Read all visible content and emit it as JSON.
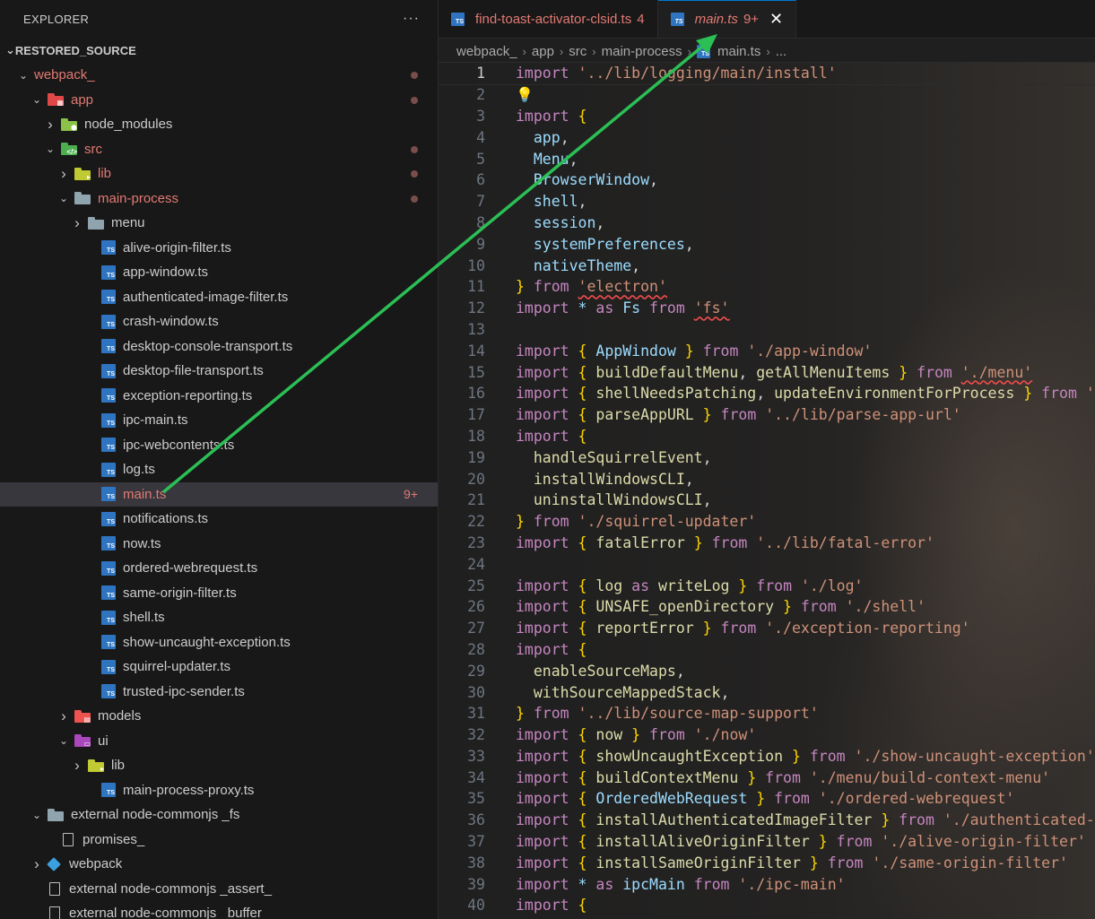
{
  "sidebar": {
    "title": "EXPLORER",
    "more_label": "···",
    "section": "RESTORED_SOURCE",
    "rows": [
      {
        "label": "webpack_",
        "indent": 0,
        "kind": "folder-open",
        "color": "#e27a73",
        "folder": "none",
        "mod": "dot"
      },
      {
        "label": "app",
        "indent": 1,
        "kind": "folder-open",
        "color": "#e27a73",
        "folder": "#e04848",
        "glyph": "▦",
        "mod": "dot"
      },
      {
        "label": "node_modules",
        "indent": 2,
        "kind": "folder-closed",
        "color": "#cccccc",
        "folder": "#8bc34a",
        "glyph": "⬢",
        "mod": ""
      },
      {
        "label": "src",
        "indent": 2,
        "kind": "folder-open",
        "color": "#e27a73",
        "folder": "#4caf50",
        "glyph": "</>",
        "mod": "dot"
      },
      {
        "label": "lib",
        "indent": 3,
        "kind": "folder-closed",
        "color": "#e27a73",
        "folder": "#c0ca33",
        "glyph": "▸",
        "mod": "dot"
      },
      {
        "label": "main-process",
        "indent": 3,
        "kind": "folder-open",
        "color": "#e27a73",
        "folder": "#90a4ae",
        "glyph": "",
        "mod": "dot"
      },
      {
        "label": "menu",
        "indent": 4,
        "kind": "folder-closed",
        "color": "#cccccc",
        "folder": "#90a4ae",
        "glyph": "",
        "mod": ""
      },
      {
        "label": "alive-origin-filter.ts",
        "indent": 5,
        "kind": "ts",
        "color": "#cccccc",
        "mod": ""
      },
      {
        "label": "app-window.ts",
        "indent": 5,
        "kind": "ts",
        "color": "#cccccc",
        "mod": ""
      },
      {
        "label": "authenticated-image-filter.ts",
        "indent": 5,
        "kind": "ts",
        "color": "#cccccc",
        "mod": ""
      },
      {
        "label": "crash-window.ts",
        "indent": 5,
        "kind": "ts",
        "color": "#cccccc",
        "mod": ""
      },
      {
        "label": "desktop-console-transport.ts",
        "indent": 5,
        "kind": "ts",
        "color": "#cccccc",
        "mod": ""
      },
      {
        "label": "desktop-file-transport.ts",
        "indent": 5,
        "kind": "ts",
        "color": "#cccccc",
        "mod": ""
      },
      {
        "label": "exception-reporting.ts",
        "indent": 5,
        "kind": "ts",
        "color": "#cccccc",
        "mod": ""
      },
      {
        "label": "ipc-main.ts",
        "indent": 5,
        "kind": "ts",
        "color": "#cccccc",
        "mod": ""
      },
      {
        "label": "ipc-webcontents.ts",
        "indent": 5,
        "kind": "ts",
        "color": "#cccccc",
        "mod": ""
      },
      {
        "label": "log.ts",
        "indent": 5,
        "kind": "ts",
        "color": "#cccccc",
        "mod": ""
      },
      {
        "label": "main.ts",
        "indent": 5,
        "kind": "ts",
        "color": "#e27a73",
        "mod": "9+",
        "selected": true
      },
      {
        "label": "notifications.ts",
        "indent": 5,
        "kind": "ts",
        "color": "#cccccc",
        "mod": ""
      },
      {
        "label": "now.ts",
        "indent": 5,
        "kind": "ts",
        "color": "#cccccc",
        "mod": ""
      },
      {
        "label": "ordered-webrequest.ts",
        "indent": 5,
        "kind": "ts",
        "color": "#cccccc",
        "mod": ""
      },
      {
        "label": "same-origin-filter.ts",
        "indent": 5,
        "kind": "ts",
        "color": "#cccccc",
        "mod": ""
      },
      {
        "label": "shell.ts",
        "indent": 5,
        "kind": "ts",
        "color": "#cccccc",
        "mod": ""
      },
      {
        "label": "show-uncaught-exception.ts",
        "indent": 5,
        "kind": "ts",
        "color": "#cccccc",
        "mod": ""
      },
      {
        "label": "squirrel-updater.ts",
        "indent": 5,
        "kind": "ts",
        "color": "#cccccc",
        "mod": ""
      },
      {
        "label": "trusted-ipc-sender.ts",
        "indent": 5,
        "kind": "ts",
        "color": "#cccccc",
        "mod": ""
      },
      {
        "label": "models",
        "indent": 3,
        "kind": "folder-closed",
        "color": "#cccccc",
        "folder": "#ef5350",
        "glyph": "▤",
        "mod": ""
      },
      {
        "label": "ui",
        "indent": 3,
        "kind": "folder-open",
        "color": "#cccccc",
        "folder": "#ab47bc",
        "glyph": "▭",
        "mod": ""
      },
      {
        "label": "lib",
        "indent": 4,
        "kind": "folder-closed",
        "color": "#cccccc",
        "folder": "#c0ca33",
        "glyph": "▸",
        "mod": ""
      },
      {
        "label": "main-process-proxy.ts",
        "indent": 5,
        "kind": "ts",
        "color": "#cccccc",
        "mod": ""
      },
      {
        "label": "external node-commonjs _fs",
        "indent": 1,
        "kind": "folder-open",
        "color": "#cccccc",
        "folder": "#90a4ae",
        "glyph": "",
        "mod": ""
      },
      {
        "label": "promises_",
        "indent": 2,
        "kind": "page",
        "color": "#cccccc",
        "mod": ""
      },
      {
        "label": "webpack",
        "indent": 1,
        "kind": "box-closed",
        "color": "#cccccc",
        "mod": ""
      },
      {
        "label": "external node-commonjs _assert_",
        "indent": 1,
        "kind": "page-flat",
        "color": "#cccccc",
        "mod": ""
      },
      {
        "label": "external node-commonjs _buffer",
        "indent": 1,
        "kind": "page-flat",
        "color": "#cccccc",
        "mod": ""
      }
    ]
  },
  "tabs": [
    {
      "label": "find-toast-activator-clsid.ts",
      "problems": "4",
      "active": false
    },
    {
      "label": "main.ts",
      "problems": "9+",
      "active": true,
      "close": "✕"
    }
  ],
  "breadcrumb": [
    "webpack_",
    "app",
    "src",
    "main-process",
    "main.ts",
    "..."
  ],
  "code": [
    [
      [
        "kw",
        "import "
      ],
      [
        "str",
        "'../lib/logging/main/install'"
      ]
    ],
    [
      [
        "bulb",
        "💡"
      ]
    ],
    [
      [
        "kw",
        "import "
      ],
      [
        "brace",
        "{"
      ]
    ],
    [
      [
        "txt",
        "  "
      ],
      [
        "var",
        "app"
      ],
      [
        "txt",
        ","
      ]
    ],
    [
      [
        "txt",
        "  "
      ],
      [
        "var",
        "Menu"
      ],
      [
        "txt",
        ","
      ]
    ],
    [
      [
        "txt",
        "  "
      ],
      [
        "var",
        "BrowserWindow"
      ],
      [
        "txt",
        ","
      ]
    ],
    [
      [
        "txt",
        "  "
      ],
      [
        "var",
        "shell"
      ],
      [
        "txt",
        ","
      ]
    ],
    [
      [
        "txt",
        "  "
      ],
      [
        "var",
        "session"
      ],
      [
        "txt",
        ","
      ]
    ],
    [
      [
        "txt",
        "  "
      ],
      [
        "var",
        "systemPreferences"
      ],
      [
        "txt",
        ","
      ]
    ],
    [
      [
        "txt",
        "  "
      ],
      [
        "var",
        "nativeTheme"
      ],
      [
        "txt",
        ","
      ]
    ],
    [
      [
        "brace",
        "}"
      ],
      [
        "kw",
        " from "
      ],
      [
        "str squig",
        "'electron'"
      ]
    ],
    [
      [
        "kw",
        "import "
      ],
      [
        "var",
        "* "
      ],
      [
        "kw",
        "as "
      ],
      [
        "var",
        "Fs "
      ],
      [
        "kw",
        "from "
      ],
      [
        "str squig",
        "'fs'"
      ]
    ],
    [],
    [
      [
        "kw",
        "import "
      ],
      [
        "brace",
        "{ "
      ],
      [
        "var",
        "AppWindow "
      ],
      [
        "brace",
        "}"
      ],
      [
        "kw",
        " from "
      ],
      [
        "str",
        "'./app-window'"
      ]
    ],
    [
      [
        "kw",
        "import "
      ],
      [
        "brace",
        "{ "
      ],
      [
        "fn",
        "buildDefaultMenu"
      ],
      [
        "txt",
        ", "
      ],
      [
        "fn",
        "getAllMenuItems "
      ],
      [
        "brace",
        "}"
      ],
      [
        "kw",
        " from "
      ],
      [
        "str squig",
        "'./menu'"
      ]
    ],
    [
      [
        "kw",
        "import "
      ],
      [
        "brace",
        "{ "
      ],
      [
        "fn",
        "shellNeedsPatching"
      ],
      [
        "txt",
        ", "
      ],
      [
        "fn",
        "updateEnvironmentForProcess "
      ],
      [
        "brace",
        "}"
      ],
      [
        "kw",
        " from "
      ],
      [
        "str",
        "'..."
      ]
    ],
    [
      [
        "kw",
        "import "
      ],
      [
        "brace",
        "{ "
      ],
      [
        "fn",
        "parseAppURL "
      ],
      [
        "brace",
        "}"
      ],
      [
        "kw",
        " from "
      ],
      [
        "str",
        "'../lib/parse-app-url'"
      ]
    ],
    [
      [
        "kw",
        "import "
      ],
      [
        "brace",
        "{"
      ]
    ],
    [
      [
        "txt",
        "  "
      ],
      [
        "fn",
        "handleSquirrelEvent"
      ],
      [
        "txt",
        ","
      ]
    ],
    [
      [
        "txt",
        "  "
      ],
      [
        "fn",
        "installWindowsCLI"
      ],
      [
        "txt",
        ","
      ]
    ],
    [
      [
        "txt",
        "  "
      ],
      [
        "fn",
        "uninstallWindowsCLI"
      ],
      [
        "txt",
        ","
      ]
    ],
    [
      [
        "brace",
        "}"
      ],
      [
        "kw",
        " from "
      ],
      [
        "str",
        "'./squirrel-updater'"
      ]
    ],
    [
      [
        "kw",
        "import "
      ],
      [
        "brace",
        "{ "
      ],
      [
        "fn",
        "fatalError "
      ],
      [
        "brace",
        "}"
      ],
      [
        "kw",
        " from "
      ],
      [
        "str",
        "'../lib/fatal-error'"
      ]
    ],
    [],
    [
      [
        "kw",
        "import "
      ],
      [
        "brace",
        "{ "
      ],
      [
        "fn",
        "log "
      ],
      [
        "kw",
        "as "
      ],
      [
        "fn",
        "writeLog "
      ],
      [
        "brace",
        "}"
      ],
      [
        "kw",
        " from "
      ],
      [
        "str",
        "'./log'"
      ]
    ],
    [
      [
        "kw",
        "import "
      ],
      [
        "brace",
        "{ "
      ],
      [
        "fn",
        "UNSAFE_openDirectory "
      ],
      [
        "brace",
        "}"
      ],
      [
        "kw",
        " from "
      ],
      [
        "str",
        "'./shell'"
      ]
    ],
    [
      [
        "kw",
        "import "
      ],
      [
        "brace",
        "{ "
      ],
      [
        "fn",
        "reportError "
      ],
      [
        "brace",
        "}"
      ],
      [
        "kw",
        " from "
      ],
      [
        "str",
        "'./exception-reporting'"
      ]
    ],
    [
      [
        "kw",
        "import "
      ],
      [
        "brace",
        "{"
      ]
    ],
    [
      [
        "txt",
        "  "
      ],
      [
        "fn",
        "enableSourceMaps"
      ],
      [
        "txt",
        ","
      ]
    ],
    [
      [
        "txt",
        "  "
      ],
      [
        "fn",
        "withSourceMappedStack"
      ],
      [
        "txt",
        ","
      ]
    ],
    [
      [
        "brace",
        "}"
      ],
      [
        "kw",
        " from "
      ],
      [
        "str",
        "'../lib/source-map-support'"
      ]
    ],
    [
      [
        "kw",
        "import "
      ],
      [
        "brace",
        "{ "
      ],
      [
        "fn",
        "now "
      ],
      [
        "brace",
        "}"
      ],
      [
        "kw",
        " from "
      ],
      [
        "str",
        "'./now'"
      ]
    ],
    [
      [
        "kw",
        "import "
      ],
      [
        "brace",
        "{ "
      ],
      [
        "fn",
        "showUncaughtException "
      ],
      [
        "brace",
        "}"
      ],
      [
        "kw",
        " from "
      ],
      [
        "str",
        "'./show-uncaught-exception'"
      ]
    ],
    [
      [
        "kw",
        "import "
      ],
      [
        "brace",
        "{ "
      ],
      [
        "fn",
        "buildContextMenu "
      ],
      [
        "brace",
        "}"
      ],
      [
        "kw",
        " from "
      ],
      [
        "str",
        "'./menu/build-context-menu'"
      ]
    ],
    [
      [
        "kw",
        "import "
      ],
      [
        "brace",
        "{ "
      ],
      [
        "var",
        "OrderedWebRequest "
      ],
      [
        "brace",
        "}"
      ],
      [
        "kw",
        " from "
      ],
      [
        "str",
        "'./ordered-webrequest'"
      ]
    ],
    [
      [
        "kw",
        "import "
      ],
      [
        "brace",
        "{ "
      ],
      [
        "fn",
        "installAuthenticatedImageFilter "
      ],
      [
        "brace",
        "}"
      ],
      [
        "kw",
        " from "
      ],
      [
        "str",
        "'./authenticated-ima"
      ]
    ],
    [
      [
        "kw",
        "import "
      ],
      [
        "brace",
        "{ "
      ],
      [
        "fn",
        "installAliveOriginFilter "
      ],
      [
        "brace",
        "}"
      ],
      [
        "kw",
        " from "
      ],
      [
        "str",
        "'./alive-origin-filter'"
      ]
    ],
    [
      [
        "kw",
        "import "
      ],
      [
        "brace",
        "{ "
      ],
      [
        "fn",
        "installSameOriginFilter "
      ],
      [
        "brace",
        "}"
      ],
      [
        "kw",
        " from "
      ],
      [
        "str",
        "'./same-origin-filter'"
      ]
    ],
    [
      [
        "kw",
        "import "
      ],
      [
        "var",
        "* "
      ],
      [
        "kw",
        "as "
      ],
      [
        "var",
        "ipcMain "
      ],
      [
        "kw",
        "from "
      ],
      [
        "str",
        "'./ipc-main'"
      ]
    ],
    [
      [
        "kw",
        "import "
      ],
      [
        "brace",
        "{"
      ]
    ]
  ],
  "colors": {
    "accent": "#0078d4",
    "modified": "#e27a73",
    "arrow": "#2bbf55"
  }
}
